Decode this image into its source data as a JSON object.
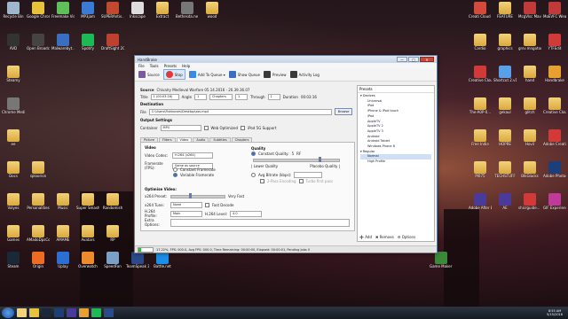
{
  "desktop": {
    "icons": [
      {
        "label": "Recycle Bin",
        "color": "#9fb7cc"
      },
      {
        "label": "Google Chrome",
        "color": "#e8c23a"
      },
      {
        "label": "Freemake Video Do...",
        "color": "#5fc05a"
      },
      {
        "label": "MP3jam",
        "color": "#3a7bd5"
      },
      {
        "label": "SUPERAntis... Free Edition",
        "color": "#c2482f"
      },
      {
        "label": "Inkscape",
        "color": "#dddddd"
      },
      {
        "label": "Extract",
        "color": "#f4d27a"
      },
      {
        "label": "Bethesda.ne Launcher",
        "color": "#777777"
      },
      {
        "label": "wood",
        "color": "#f4d27a"
      },
      {
        "label": "AVD",
        "color": "#333333"
      },
      {
        "label": "Open Broadcast...",
        "color": "#444444"
      },
      {
        "label": "Malwarebyt... Anti-Malware",
        "color": "#3a6ec0"
      },
      {
        "label": "Spotify",
        "color": "#1db954"
      },
      {
        "label": "DraftSight 2015 x64",
        "color": "#c04030"
      },
      {
        "label": "Steamy",
        "color": "#f4d27a"
      },
      {
        "label": "Chrome Medieval II ...",
        "color": "#777777"
      },
      {
        "label": "ee",
        "color": "#f4d27a"
      },
      {
        "label": "Docs",
        "color": "#f4d27a"
      },
      {
        "label": "sploorion",
        "color": "#f4d27a"
      },
      {
        "label": "Volyes",
        "color": "#f4d27a"
      },
      {
        "label": "Personalities",
        "color": "#f4d27a"
      },
      {
        "label": "Music",
        "color": "#f4d27a"
      },
      {
        "label": "Super Smash Bros. Fo...",
        "color": "#f4d27a"
      },
      {
        "label": "Randomish",
        "color": "#f4d27a"
      },
      {
        "label": "Games",
        "color": "#f4d27a"
      },
      {
        "label": "AMadoDpsCo",
        "color": "#f4d27a"
      },
      {
        "label": "AMAME",
        "color": "#f4d27a"
      },
      {
        "label": "Avatars",
        "color": "#f4d27a"
      },
      {
        "label": "RP",
        "color": "#f4d27a"
      },
      {
        "label": "Steam",
        "color": "#1b2838"
      },
      {
        "label": "Origin",
        "color": "#f06b22"
      },
      {
        "label": "Uplay",
        "color": "#2a6fd1"
      },
      {
        "label": "Overwatch",
        "color": "#ee8a2b"
      },
      {
        "label": "SpeedFan",
        "color": "#7aa0c8"
      },
      {
        "label": "TeamSpeak 3 Client",
        "color": "#2a4a8a"
      },
      {
        "label": "Battle.net",
        "color": "#1a8ee8"
      },
      {
        "label": "Creati Cloud Me...",
        "color": "#d24a3a"
      },
      {
        "label": "FEATURE",
        "color": "#f4d27a"
      },
      {
        "label": "McgVlsc Mavis",
        "color": "#c03a3a"
      },
      {
        "label": "MoEVFC Weaving",
        "color": "#c03a3a"
      },
      {
        "label": "Cardio",
        "color": "#f4d27a"
      },
      {
        "label": "graphics",
        "color": "#f4d27a"
      },
      {
        "label": "grsv.mngotoo",
        "color": "#f4d27a"
      },
      {
        "label": "YTFEdit",
        "color": "#d23a3a"
      },
      {
        "label": "Creative Cloud",
        "color": "#d23a3a"
      },
      {
        "label": "Shortcut 2.v1.4",
        "color": "#5aa0e8"
      },
      {
        "label": "hand",
        "color": "#f4d27a"
      },
      {
        "label": "Handbrake",
        "color": "#e8a030"
      },
      {
        "label": "The-A0P-0...",
        "color": "#f4d27a"
      },
      {
        "label": "gekaul",
        "color": "#f4d27a"
      },
      {
        "label": "glitch",
        "color": "#f4d27a"
      },
      {
        "label": "Creative Cloud (ALL Adobe...)",
        "color": "#f4d27a"
      },
      {
        "label": "Free Indie",
        "color": "#f4d27a"
      },
      {
        "label": "HOPRE",
        "color": "#f4d27a"
      },
      {
        "label": "Hovil",
        "color": "#f4d27a"
      },
      {
        "label": "Adobe Creative Cloud",
        "color": "#d23a3a"
      },
      {
        "label": "Pl075",
        "color": "#f4d27a"
      },
      {
        "label": "TECHSTUFF",
        "color": "#f4d27a"
      },
      {
        "label": "BlkGlacks",
        "color": "#f4d27a"
      },
      {
        "label": "Adobe Photoshop...",
        "color": "#1c3f7a"
      },
      {
        "label": "Adobe After Effects CC...",
        "color": "#4a3a9a"
      },
      {
        "label": "AE",
        "color": "#4a3a9a"
      },
      {
        "label": "shicrguide... Copy.pdf",
        "color": "#d23a3a"
      },
      {
        "label": "GIF Experience",
        "color": "#c03a9a"
      },
      {
        "label": "Game Maker Studio",
        "color": "#3a8a3a"
      }
    ]
  },
  "window": {
    "title": "HandBrake",
    "buttons": {
      "minimize": "—",
      "maximize": "□",
      "close": "✕"
    },
    "menu": [
      "File",
      "Tools",
      "Presets",
      "Help"
    ],
    "toolbar": [
      {
        "label": "Source",
        "icon": "film-icon",
        "color": "#7a5a9a"
      },
      {
        "label": "Stop",
        "icon": "stop-icon",
        "color": "#e03a3a"
      },
      {
        "label": "Add To Queue ▾",
        "icon": "add-queue-icon",
        "color": "#3a8ae0"
      },
      {
        "label": "Show Queue",
        "icon": "queue-icon",
        "color": "#3a6ec0"
      },
      {
        "label": "Preview",
        "icon": "preview-icon",
        "color": "#3a3a3a"
      },
      {
        "label": "Activity Log",
        "icon": "log-icon",
        "color": "#3a3a3a"
      }
    ],
    "source": {
      "label": "Source",
      "value": "Chivalry  Medieval Warfare 05.14.2016 - 20.39.36.07",
      "title_label": "Title",
      "title_value": "1 (00:03:16)",
      "angle_label": "Angle",
      "angle_value": "1",
      "chapters_value": "Chapters",
      "from_value": "1",
      "through_label": "Through",
      "through_value": "1",
      "duration_label": "Duration",
      "duration_value": "00:03:16"
    },
    "destination": {
      "section": "Destination",
      "file_label": "File",
      "file_value": "C:\\Users\\Fishbones\\Desktop\\sss.mp4",
      "browse": "Browse"
    },
    "output": {
      "section": "Output Settings",
      "container_label": "Container",
      "container_value": "MP4",
      "web_optimized": "Web Optimized",
      "ipod": "iPod 5G Support"
    },
    "tabs": [
      "Picture",
      "Filters",
      "Video",
      "Audio",
      "Subtitles",
      "Chapters"
    ],
    "video": {
      "section": "Video",
      "codec_label": "Video Codec:",
      "codec_value": "H.264 (x264)",
      "fps_label": "Framerate (FPS):",
      "fps_value": "Same as source",
      "constant_fr": "Constant Framerate",
      "variable_fr": "Variable Framerate",
      "quality_section": "Quality",
      "constant_quality": "Constant Quality:",
      "cq_value": "5",
      "rf": "RF",
      "lower_quality": "| Lower Quality",
      "placebo_quality": "Placebo Quality |",
      "avg_bitrate": "Avg Bitrate (kbps):",
      "two_pass": "2-Pass Encoding",
      "turbo": "Turbo first pass",
      "opt_section": "Optimise Video:",
      "preset_label": "x264 Preset:",
      "preset_value": "Very Fast",
      "tune_label": "x264 Tune:",
      "tune_value": "None",
      "fast_decode": "Fast Decode",
      "profile_label": "H.264 Profile:",
      "profile_value": "Main",
      "level_label": "H.264 Level:",
      "level_value": "4.0",
      "extra_label": "Extra Options:"
    },
    "presets": {
      "title": "Presets",
      "items": [
        {
          "text": "▾ Devices",
          "kind": "grp"
        },
        {
          "text": "Universal",
          "kind": "item"
        },
        {
          "text": "iPod",
          "kind": "item"
        },
        {
          "text": "iPhone & iPod touch",
          "kind": "item"
        },
        {
          "text": "iPad",
          "kind": "item"
        },
        {
          "text": "AppleTV",
          "kind": "item"
        },
        {
          "text": "AppleTV 2",
          "kind": "item"
        },
        {
          "text": "AppleTV 3",
          "kind": "item"
        },
        {
          "text": "Android",
          "kind": "item"
        },
        {
          "text": "Android Tablet",
          "kind": "item"
        },
        {
          "text": "Windows Phone 8",
          "kind": "item"
        },
        {
          "text": "▾ Regular",
          "kind": "grp"
        },
        {
          "text": "Normal",
          "kind": "sel"
        },
        {
          "text": "High Profile",
          "kind": "item"
        }
      ],
      "add": "Add",
      "remove": "Remove",
      "options": "Options"
    },
    "status": {
      "progress_pct": 17,
      "text": "17.22%,  FPS: 000.0,  Avg FPS: 000.0,  Time Remaining: 00:00:00,  Elapsed: 00:00:01,  Pending Jobs 0"
    }
  },
  "taskbar": {
    "apps": [
      {
        "name": "explorer-icon",
        "color": "#f4d27a"
      },
      {
        "name": "chrome-icon",
        "color": "#e8c23a"
      },
      {
        "name": "steam-icon",
        "color": "#1b2838"
      },
      {
        "name": "photoshop-icon",
        "color": "#1c3f7a"
      },
      {
        "name": "after-effects-icon",
        "color": "#4a3a9a"
      },
      {
        "name": "handbrake-icon",
        "color": "#e8a030"
      },
      {
        "name": "spotify-icon",
        "color": "#1db954"
      },
      {
        "name": "teamspeak-icon",
        "color": "#2a4a8a"
      }
    ],
    "time": "8:55 AM",
    "date": "5/15/2016"
  }
}
